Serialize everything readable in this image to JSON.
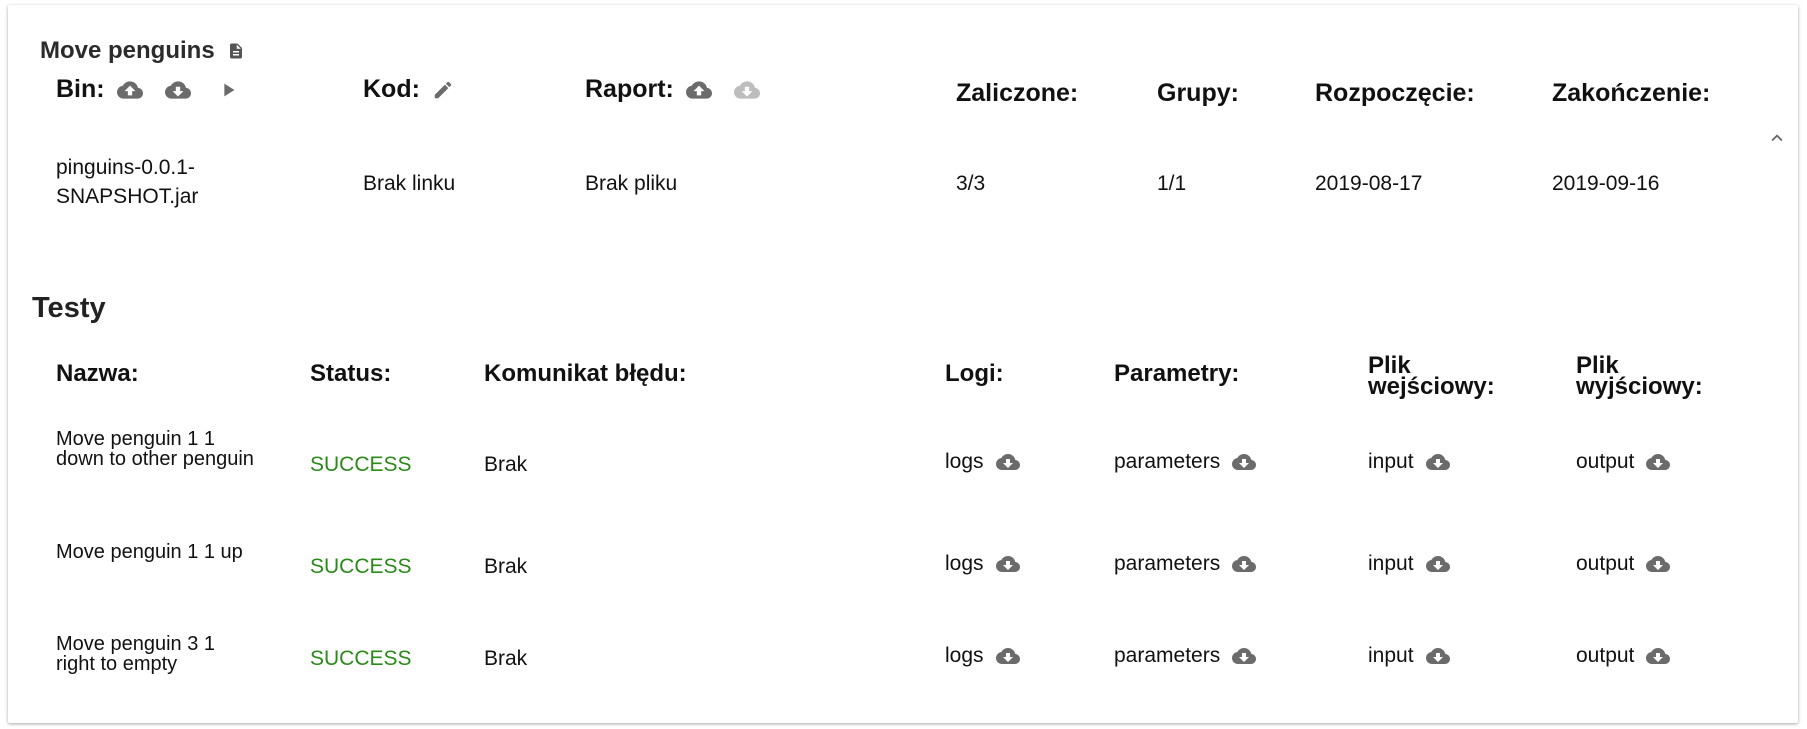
{
  "task": {
    "title": "Move penguins",
    "headers": {
      "bin": "Bin:",
      "kod": "Kod:",
      "raport": "Raport:",
      "zaliczone": "Zaliczone:",
      "grupy": "Grupy:",
      "rozpoczecie": "Rozpoczęcie:",
      "zakonczenie": "Zakończenie:"
    },
    "values": {
      "bin": "pinguins-0.0.1-SNAPSHOT.jar",
      "kod": "Brak linku",
      "raport": "Brak pliku",
      "zaliczone": "3/3",
      "grupy": "1/1",
      "rozpoczecie": "2019-08-17",
      "zakonczenie": "2019-09-16"
    }
  },
  "tests": {
    "title": "Testy",
    "headers": {
      "nazwa": "Nazwa:",
      "status": "Status:",
      "komunikat": "Komunikat błędu:",
      "logi": "Logi:",
      "parametry": "Parametry:",
      "wejsciowy": "Plik wejściowy:",
      "wyjsciowy": "Plik wyjściowy:"
    },
    "rows": [
      {
        "name": "Move penguin 1 1 down to other penguin",
        "status": "SUCCESS",
        "error": "Brak",
        "logs": "logs",
        "parameters": "parameters",
        "input": "input",
        "output": "output"
      },
      {
        "name": "Move penguin 1 1 up",
        "status": "SUCCESS",
        "error": "Brak",
        "logs": "logs",
        "parameters": "parameters",
        "input": "input",
        "output": "output"
      },
      {
        "name": "Move penguin 3 1 right to empty",
        "status": "SUCCESS",
        "error": "Brak",
        "logs": "logs",
        "parameters": "parameters",
        "input": "input",
        "output": "output"
      }
    ]
  },
  "colors": {
    "success": "#2a8a1a",
    "icon": "#6b6b6b",
    "icon_disabled": "#bdbdbd"
  }
}
